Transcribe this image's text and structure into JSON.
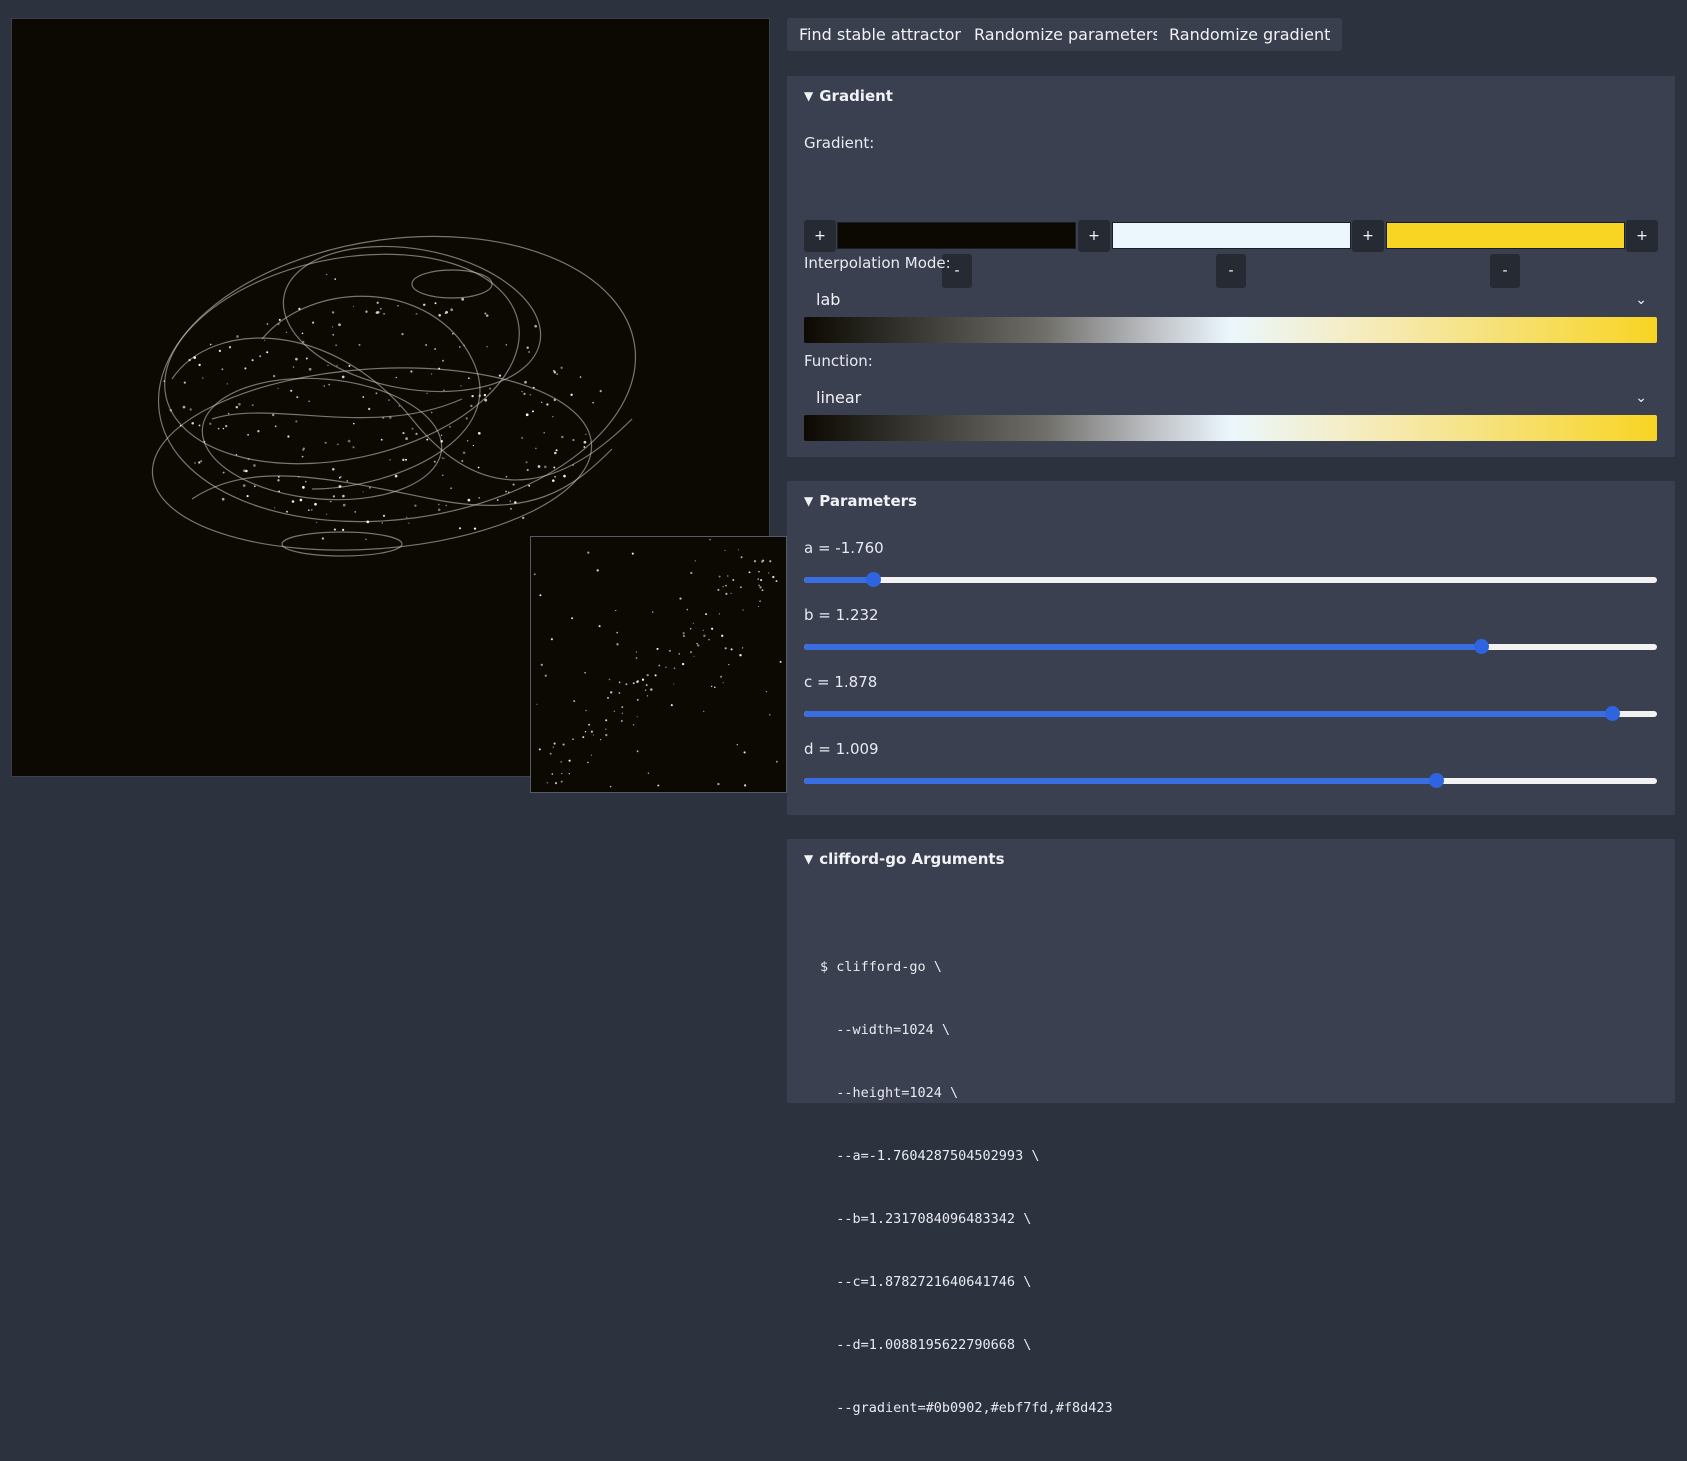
{
  "toolbar": {
    "find_label": "Find stable attractor",
    "randomize_params_label": "Randomize parameters",
    "randomize_gradient_label": "Randomize gradient"
  },
  "gradient_panel": {
    "title": "Gradient",
    "gradient_label": "Gradient:",
    "plus": "+",
    "minus": "-",
    "stops": [
      "#0b0902",
      "#ebf7fd",
      "#f8d423"
    ],
    "interpolation_label": "Interpolation Mode:",
    "interpolation_value": "lab",
    "function_label": "Function:",
    "function_value": "linear"
  },
  "parameters_panel": {
    "title": "Parameters",
    "sliders": [
      {
        "label": "a = -1.760",
        "value": -1.76,
        "fraction": 0.082
      },
      {
        "label": "b = 1.232",
        "value": 1.232,
        "fraction": 0.795
      },
      {
        "label": "c = 1.878",
        "value": 1.878,
        "fraction": 0.948
      },
      {
        "label": "d = 1.009",
        "value": 1.009,
        "fraction": 0.742
      }
    ]
  },
  "args_panel": {
    "title": "clifford-go Arguments",
    "lines": [
      "$ clifford-go \\",
      "  --width=1024 \\",
      "  --height=1024 \\",
      "  --a=-1.7604287504502993 \\",
      "  --b=1.2317084096483342 \\",
      "  --c=1.8782721640641746 \\",
      "  --d=1.0088195622790668 \\",
      "  --gradient=#0b0902,#ebf7fd,#f8d423"
    ]
  },
  "colors": {
    "background": "#2d323f",
    "panel": "#3b4050",
    "canvas": "#0b0902",
    "accent": "#3a6ee0"
  }
}
